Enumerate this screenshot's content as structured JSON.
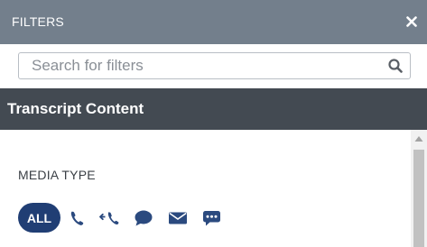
{
  "header": {
    "title": "FILTERS",
    "close_icon": "close-icon"
  },
  "search": {
    "placeholder": "Search for filters",
    "value": "",
    "icon": "search-icon"
  },
  "section": {
    "title": "Transcript Content"
  },
  "media_type": {
    "label": "MEDIA TYPE",
    "options": [
      {
        "label": "ALL",
        "selected": true
      },
      {
        "icon": "phone-icon"
      },
      {
        "icon": "transfer-call-icon"
      },
      {
        "icon": "chat-bubble-icon"
      },
      {
        "icon": "email-icon"
      },
      {
        "icon": "sms-icon"
      }
    ]
  },
  "colors": {
    "header_bg": "#737f8c",
    "section_bg": "#434a52",
    "accent": "#203e74",
    "icon": "#2b4a7f"
  }
}
